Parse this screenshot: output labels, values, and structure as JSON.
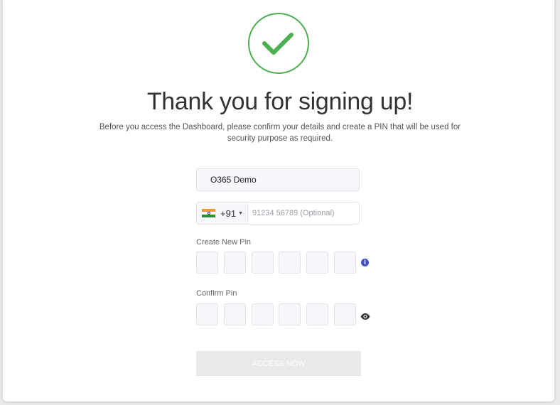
{
  "header": {
    "title": "Thank you for signing up!",
    "subtitle": "Before you access the Dashboard, please confirm your details and create a PIN that will be used for security purpose as required."
  },
  "form": {
    "name_value": "O365 Demo",
    "phone": {
      "country_code": "+91",
      "placeholder": "91234 56789 (Optional)",
      "value": ""
    },
    "create_pin_label": "Create New Pin",
    "confirm_pin_label": "Confirm Pin",
    "submit_label": "ACCESS NOW"
  },
  "icons": {
    "success": "check-circle-icon",
    "flag": "india-flag-icon",
    "info": "info-icon",
    "show_pin": "eye-icon"
  },
  "colors": {
    "success": "#4caf50",
    "info": "#3b55c4",
    "button_disabled": "#e9e9e9"
  }
}
